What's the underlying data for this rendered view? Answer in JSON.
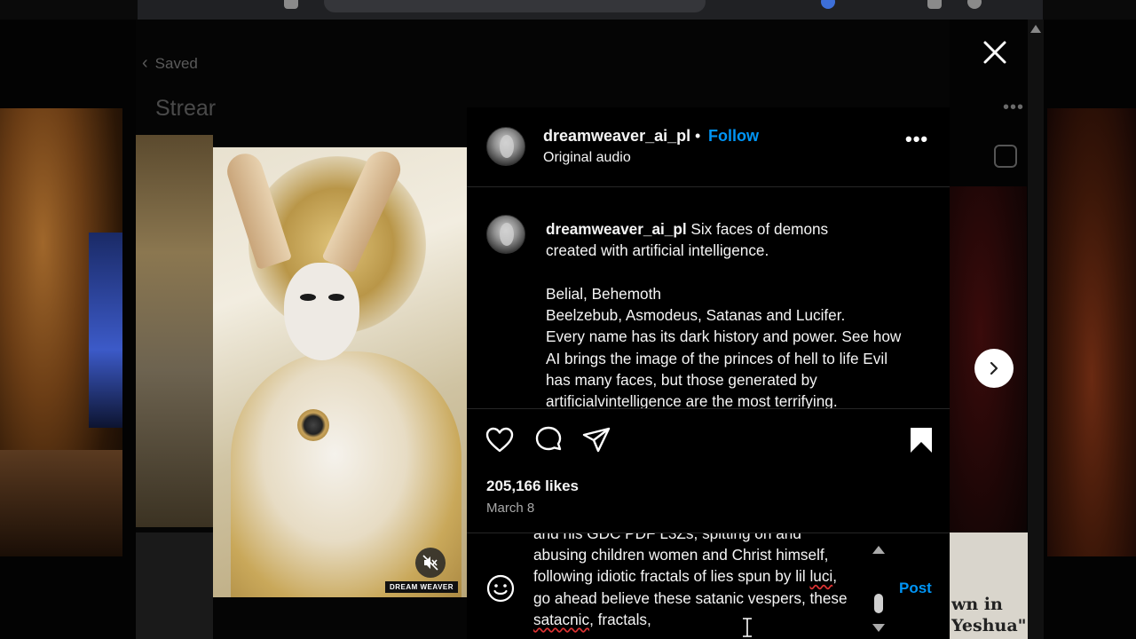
{
  "background": {
    "back_label": "Saved",
    "collection_title": "Strear",
    "right_image_caption_line1": "wn in",
    "right_image_caption_line2": "Yeshua\""
  },
  "post": {
    "username": "dreamweaver_ai_pl",
    "separator": "•",
    "follow_label": "Follow",
    "audio_label": "Original audio",
    "media_watermark": "DREAM WEAVER",
    "caption": {
      "username": "dreamweaver_ai_pl",
      "line1": "Six faces of demons",
      "line2": "created with artificial intelligence.",
      "line3": "Belial, Behemoth",
      "line4": "Beelzebub, Asmodeus, Satanas and Lucifer.",
      "line5": "Every name has its dark history and power. See how",
      "line6": "AI brings the image of the princes of hell to life Evil",
      "line7": "has many faces, but those generated by",
      "line8": "artificialvintelligence are the most terrifying."
    },
    "likes": "205,166 likes",
    "date": "March 8"
  },
  "comment_input": {
    "line1": "and his GDC PDF L3Zs, spitting on and",
    "line2": "abusing children women and Christ himself,",
    "line3": "following idiotic fractals of lies spun by lil ",
    "line3_flagged": "luci",
    "line3_end": ",",
    "line4": "go ahead believe these satanic vespers, these",
    "line5_flagged": "satacnic",
    "line5_end": ", fractals,",
    "post_label": "Post"
  },
  "colors": {
    "accent": "#0095f6",
    "background": "#000000",
    "text": "#f5f5f5",
    "muted": "#a8a8a8"
  },
  "icons": [
    "close-icon",
    "more-icon",
    "heart-icon",
    "comment-icon",
    "share-icon",
    "bookmark-icon",
    "emoji-icon",
    "chevron-right-icon",
    "mute-icon",
    "chevron-left-icon",
    "reels-icon"
  ]
}
